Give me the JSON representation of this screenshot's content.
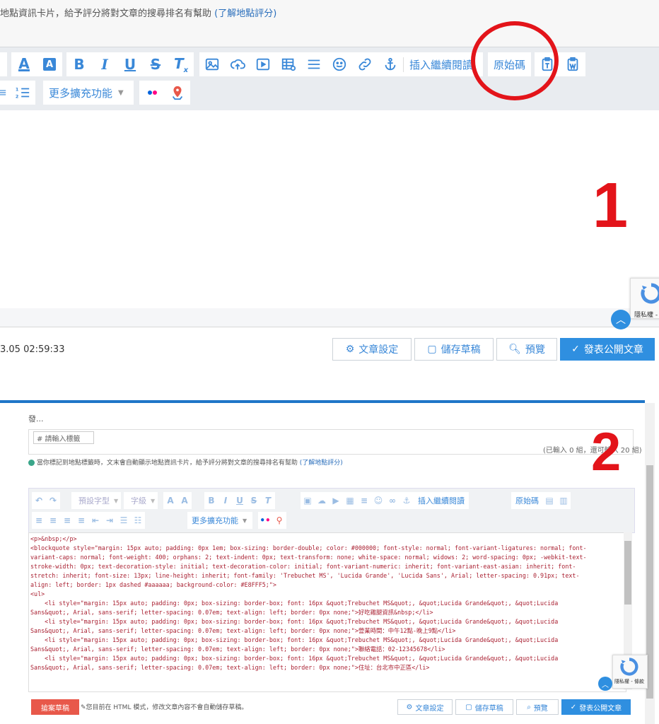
{
  "top": {
    "notice_text": "地點資訊卡片，給予評分將對文章的搜尋排名有幫助",
    "notice_link": "(了解地點評分)",
    "toolbar": {
      "insert_read_more": "插入繼續閱讀",
      "source_code": "原始碼",
      "more_plugins": "更多擴充功能"
    },
    "timestamp": "3.05 02:59:33",
    "footer": {
      "article_settings": "文章設定",
      "save_draft": "儲存草稿",
      "preview": "預覽",
      "publish": "發表公開文章"
    },
    "recaptcha_label": "隱私權 -",
    "annotation_number": "1"
  },
  "bottom": {
    "partial_text": "發...",
    "tag_placeholder": "# 請輸入標籤",
    "tag_count": "(已輸入 0 組，還可輸入 20 組)",
    "map_notice": "當你標記到地點標籤時，文末會自動顯示地點資訊卡片，給予評分將對文章的搜尋排名有幫助",
    "map_notice_link": "(了解地點評分)",
    "toolbar": {
      "font_default": "預設字型",
      "font_size": "字級",
      "insert_read_more": "插入繼續閱讀",
      "source_code": "原始碼",
      "more_plugins": "更多擴充功能"
    },
    "code_lines": [
      "<p>&nbsp;</p>",
      "",
      "<blockquote style=\"margin: 15px auto; padding: 0px 1em; box-sizing: border-double; color: #000000; font-style: normal; font-variant-ligatures: normal; font-",
      "variant-caps: normal; font-weight: 400; orphans: 2; text-indent: 0px; text-transform: none; white-space: normal; widows: 2; word-spacing: 0px; -webkit-text-",
      "stroke-width: 0px; text-decoration-style: initial; text-decoration-color: initial; font-variant-numeric: inherit; font-variant-east-asian: inherit; font-",
      "stretch: inherit; font-size: 13px; line-height: inherit; font-family: 'Trebuchet MS', 'Lucida Grande', 'Lucida Sans', Arial; letter-spacing: 0.91px; text-",
      "align: left; border: 1px dashed #aaaaaa; background-color: #E8FFF5;\">",
      "<ul>",
      "    <li style=\"margin: 15px auto; padding: 0px; box-sizing: border-box; font: 16px &quot;Trebuchet MS&quot;, &quot;Lucida Grande&quot;, &quot;Lucida",
      "Sans&quot;, Arial, sans-serif; letter-spacing: 0.07em; text-align: left; border: 0px none;\">好吃雞腿資訊&nbsp;</li>",
      "    <li style=\"margin: 15px auto; padding: 0px; box-sizing: border-box; font: 16px &quot;Trebuchet MS&quot;, &quot;Lucida Grande&quot;, &quot;Lucida",
      "Sans&quot;, Arial, sans-serif; letter-spacing: 0.07em; text-align: left; border: 0px none;\">營業時間：中午12點-晚上9點</li>",
      "    <li style=\"margin: 15px auto; padding: 0px; box-sizing: border-box; font: 16px &quot;Trebuchet MS&quot;, &quot;Lucida Grande&quot;, &quot;Lucida",
      "Sans&quot;, Arial, sans-serif; letter-spacing: 0.07em; text-align: left; border: 0px none;\">聯絡電話：02-12345678</li>",
      "    <li style=\"margin: 15px auto; padding: 0px; box-sizing: border-box; font: 16px &quot;Trebuchet MS&quot;, &quot;Lucida Grande&quot;, &quot;Lucida",
      "Sans&quot;, Arial, sans-serif; letter-spacing: 0.07em; text-align: left; border: 0px none;\">住址：台北市中正區</li>"
    ],
    "footer": {
      "draft_button": "搶案草稿",
      "html_mode_note": "您目前在 HTML 模式，修改文章內容不會自動儲存草稿。",
      "article_settings": "文章設定",
      "save_draft": "儲存草稿",
      "preview": "預覽",
      "publish": "發表公開文章"
    },
    "recaptcha_label": "隱私權 - 條款",
    "annotation_number": "2"
  },
  "colors": {
    "accent": "#3a88d8",
    "annotation": "#e3141a",
    "publish": "#2f8fe0",
    "draft": "#e8584a"
  }
}
